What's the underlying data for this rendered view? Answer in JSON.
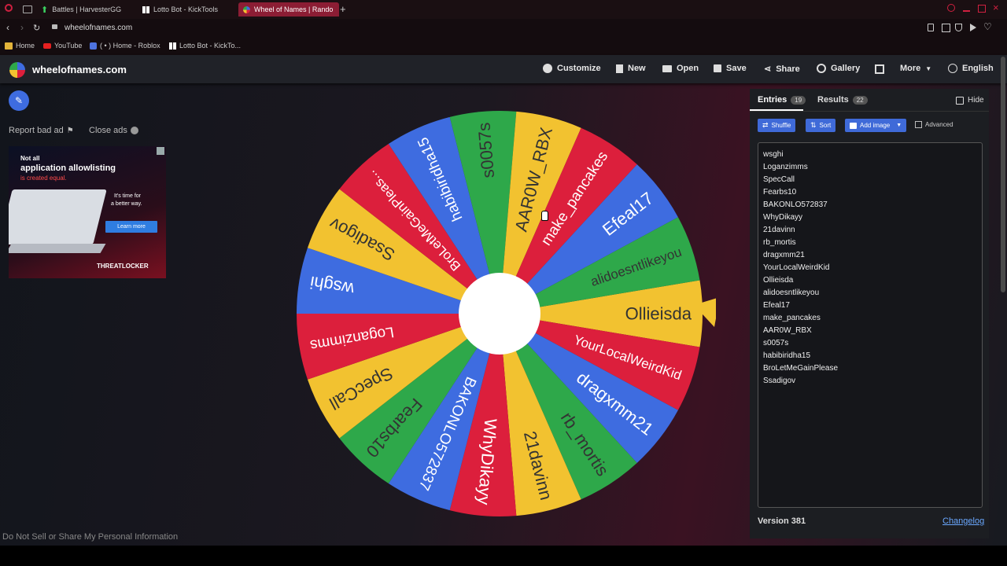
{
  "browser": {
    "tabs": [
      {
        "label": "Battles | HarvesterGG",
        "icon": "up-arrow-icon"
      },
      {
        "label": "Lotto Bot - KickTools",
        "icon": "grid-icon"
      },
      {
        "label": "Wheel of Names | Rando",
        "icon": "wheel-icon"
      }
    ],
    "url": "wheelofnames.com",
    "bookmarks": [
      {
        "label": "Home"
      },
      {
        "label": "YouTube"
      },
      {
        "label": "( • ) Home - Roblox"
      },
      {
        "label": "Lotto Bot - KickTo..."
      }
    ]
  },
  "site": {
    "title": "wheelofnames.com",
    "nav": {
      "customize": "Customize",
      "new": "New",
      "open": "Open",
      "save": "Save",
      "share": "Share",
      "gallery": "Gallery",
      "more": "More",
      "language": "English"
    },
    "ads": {
      "report": "Report bad ad",
      "close": "Close ads",
      "ad_line1": "Not all",
      "ad_line2": "application allowlisting",
      "ad_line3": "is created equal.",
      "ad_line4": "It's time for",
      "ad_line5": "a better way.",
      "ad_button": "Learn more",
      "ad_brand": "THREATLOCKER"
    },
    "footer_link": "Do Not Sell or Share My Personal Information"
  },
  "panel": {
    "entries_tab": "Entries",
    "entries_count": "19",
    "results_tab": "Results",
    "results_count": "22",
    "hide": "Hide",
    "shuffle": "Shuffle",
    "sort": "Sort",
    "add_image": "Add image",
    "advanced": "Advanced",
    "entries": [
      "wsghi",
      "Loganzimms",
      "SpecCall",
      "Fearbs10",
      "BAKONLO572837",
      "WhyDikayy",
      "21davinn",
      "rb_mortis",
      "dragxmm21",
      "YourLocalWeirdKid",
      "Ollieisda",
      "alidoesntlikeyou",
      "Efeal17",
      "make_pancakes",
      "AAR0W_RBX",
      "s0057s",
      "habibiridha15",
      "BroLetMeGainPlease",
      "Ssadigov"
    ],
    "version": "Version 381",
    "changelog": "Changelog"
  },
  "wheel": {
    "slices": [
      {
        "label": "Ollieisda",
        "color": "#f2c230"
      },
      {
        "label": "YourLocalWeirdKid",
        "color": "#dc1f3c"
      },
      {
        "label": "dragxmm21",
        "color": "#3e6ce0"
      },
      {
        "label": "rb_mortis",
        "color": "#2ea84a"
      },
      {
        "label": "21davinn",
        "color": "#f2c230"
      },
      {
        "label": "WhyDikayy",
        "color": "#dc1f3c"
      },
      {
        "label": "BAKONLO572837",
        "color": "#3e6ce0"
      },
      {
        "label": "Fearbs10",
        "color": "#2ea84a"
      },
      {
        "label": "SpecCall",
        "color": "#f2c230"
      },
      {
        "label": "Loganzimms",
        "color": "#dc1f3c"
      },
      {
        "label": "wsghi",
        "color": "#3e6ce0"
      },
      {
        "label": "Ssadigov",
        "color": "#f2c230"
      },
      {
        "label": "BroLetMeGainPleas...",
        "color": "#dc1f3c"
      },
      {
        "label": "habibiridha15",
        "color": "#3e6ce0"
      },
      {
        "label": "s0057s",
        "color": "#2ea84a"
      },
      {
        "label": "AAR0W_RBX",
        "color": "#f2c230"
      },
      {
        "label": "make_pancakes",
        "color": "#dc1f3c"
      },
      {
        "label": "Efeal17",
        "color": "#3e6ce0"
      },
      {
        "label": "alidoesntlikeyou",
        "color": "#2ea84a"
      }
    ],
    "pointer_color": "#f2c230"
  }
}
